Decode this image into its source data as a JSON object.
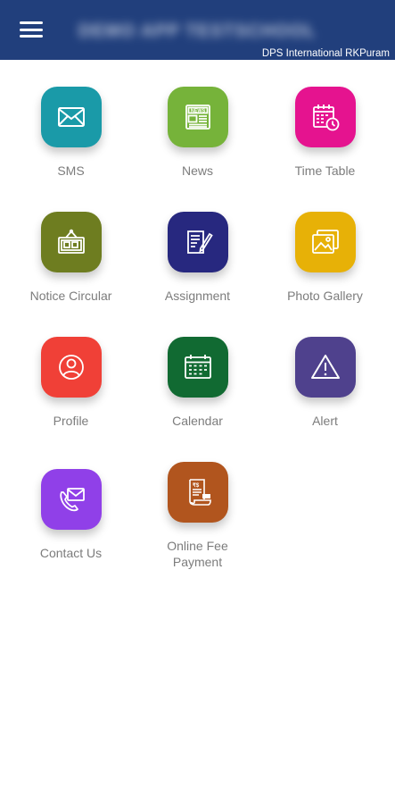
{
  "header": {
    "menu_icon": "hamburger-menu-icon",
    "title": "DEMO APP TESTSCHOOL",
    "school_name": "DPS International RKPuram",
    "background": "#213f7c"
  },
  "tiles": [
    {
      "label": "SMS",
      "icon": "envelope-icon",
      "color": "#1a9aa8"
    },
    {
      "label": "News",
      "icon": "newspaper-icon",
      "color": "#76b33a"
    },
    {
      "label": "Time Table",
      "icon": "timetable-icon",
      "color": "#e5138f"
    },
    {
      "label": "Notice Circular",
      "icon": "notice-board-icon",
      "color": "#6e7d20"
    },
    {
      "label": "Assignment",
      "icon": "assignment-icon",
      "color": "#27287f"
    },
    {
      "label": "Photo Gallery",
      "icon": "photo-gallery-icon",
      "color": "#e7b107"
    },
    {
      "label": "Profile",
      "icon": "profile-icon",
      "color": "#f04037"
    },
    {
      "label": "Calendar",
      "icon": "calendar-icon",
      "color": "#116a32"
    },
    {
      "label": "Alert",
      "icon": "alert-icon",
      "color": "#4f418d"
    },
    {
      "label": "Contact Us",
      "icon": "contact-icon",
      "color": "#9040e8"
    },
    {
      "label": "Online Fee\nPayment",
      "icon": "fee-receipt-icon",
      "color": "#b1551e"
    }
  ]
}
